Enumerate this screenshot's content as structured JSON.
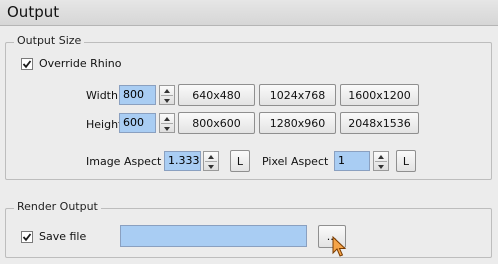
{
  "panel": {
    "title": "Output"
  },
  "output_size": {
    "legend": "Output Size",
    "override": {
      "label": "Override Rhino",
      "checked": true
    },
    "width": {
      "label": "Width",
      "value": "800"
    },
    "height": {
      "label": "Height",
      "value": "600"
    },
    "presets": [
      "640x480",
      "1024x768",
      "1600x1200",
      "800x600",
      "1280x960",
      "2048x1536"
    ],
    "image_aspect": {
      "label": "Image Aspect",
      "value": "1.333",
      "lock_label": "L"
    },
    "pixel_aspect": {
      "label": "Pixel Aspect",
      "value": "1",
      "lock_label": "L"
    }
  },
  "render_output": {
    "legend": "Render Output",
    "save_file": {
      "label": "Save file",
      "checked": true
    },
    "path": {
      "value": ""
    },
    "browse_label": "..."
  }
}
